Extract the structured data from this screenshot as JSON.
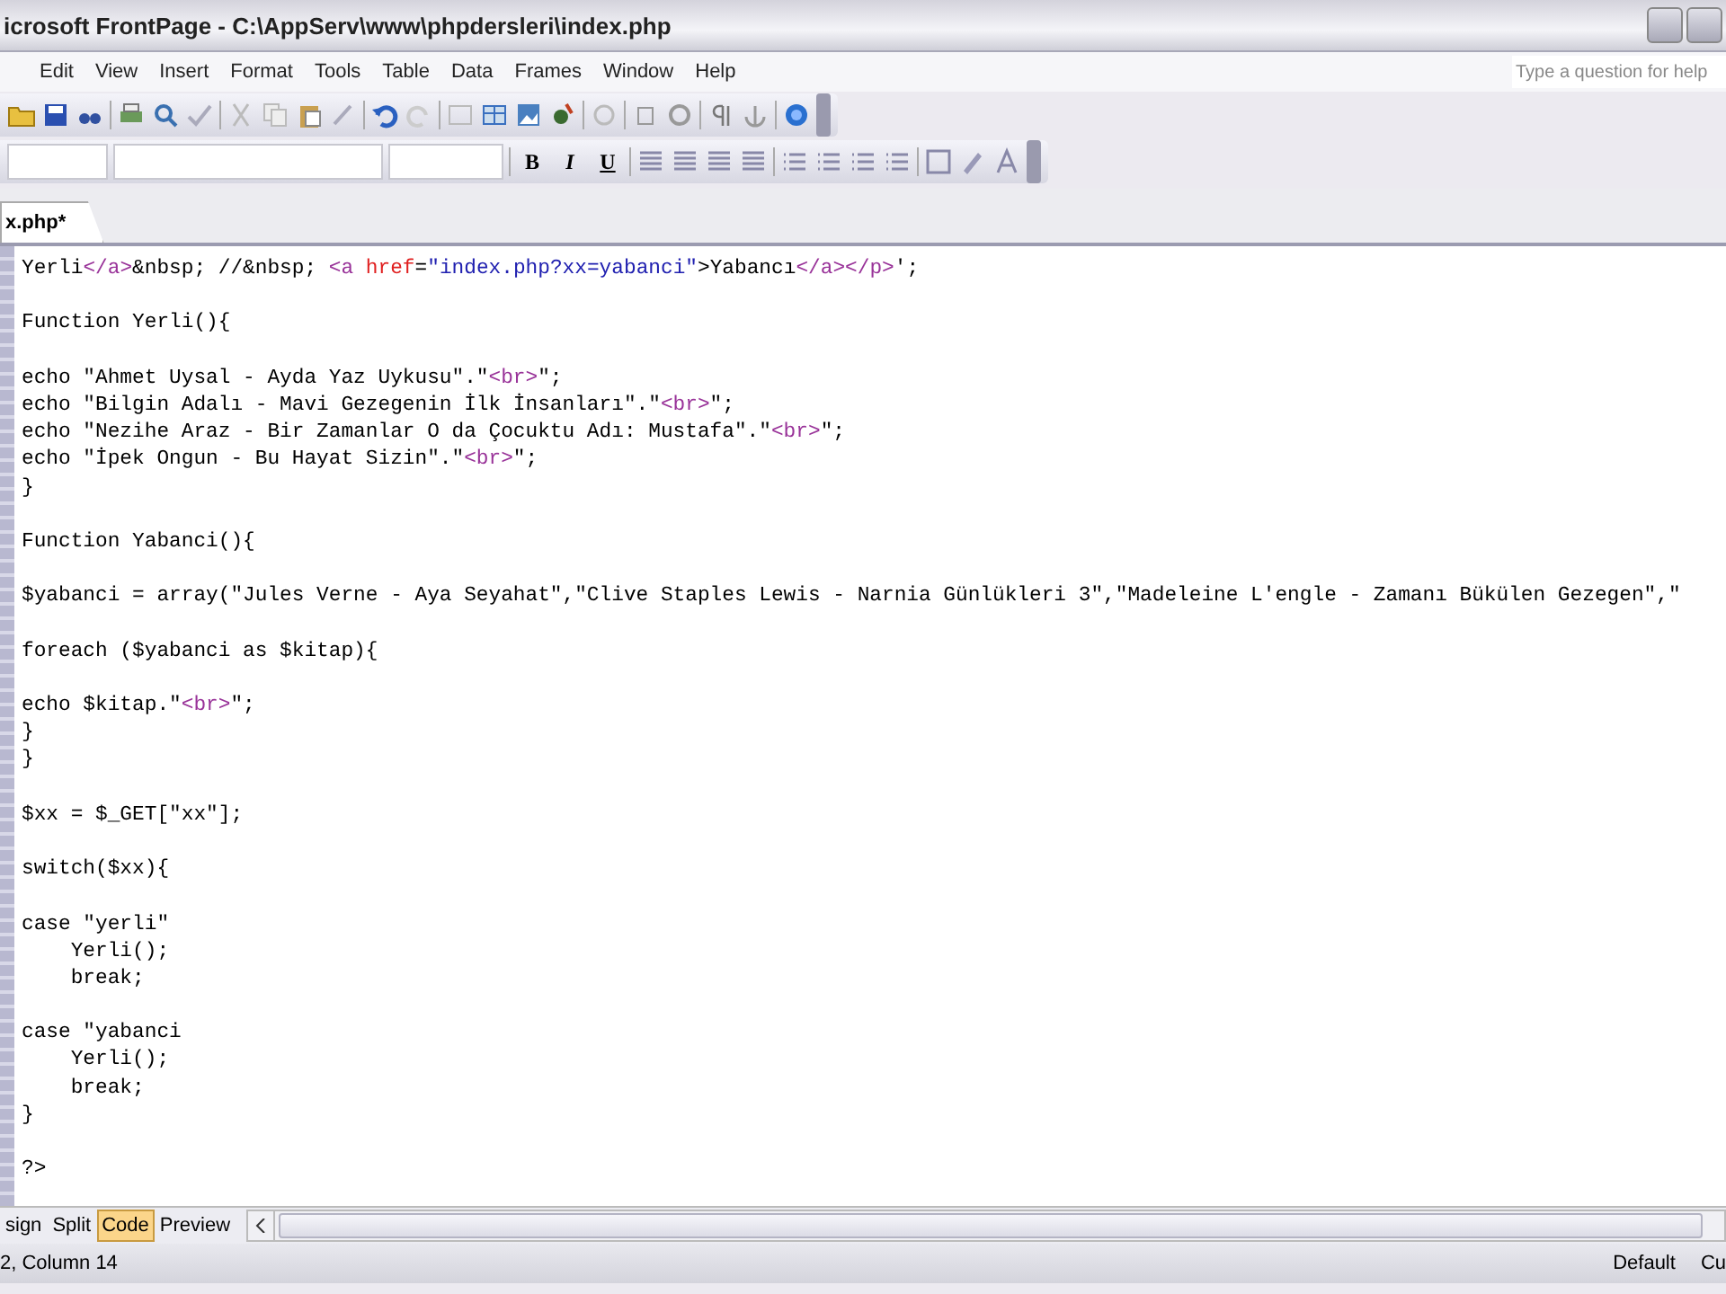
{
  "window": {
    "title": "icrosoft FrontPage - C:\\AppServ\\www\\phpdersleri\\index.php"
  },
  "menu": [
    "Edit",
    "View",
    "Insert",
    "Format",
    "Tools",
    "Table",
    "Data",
    "Frames",
    "Window",
    "Help"
  ],
  "help_box": {
    "placeholder": "Type a question for help"
  },
  "format_toolbar": {
    "buttons": [
      "B",
      "I",
      "U"
    ]
  },
  "tabs": [
    {
      "label": "x.php*",
      "selected": true
    }
  ],
  "code_blocks": [
    [
      [
        {
          "kind": "code",
          "text": "Yerli"
        },
        {
          "kind": "tag",
          "text": "</a>"
        },
        {
          "kind": "code",
          "text": "&nbsp; //&nbsp; "
        },
        {
          "kind": "tag",
          "text": "<a "
        },
        {
          "kind": "attr",
          "text": "href"
        },
        {
          "kind": "code",
          "text": "="
        },
        {
          "kind": "value",
          "text": "\"index.php?xx=yabanci\""
        },
        {
          "kind": "code",
          "text": ">Yabancı"
        },
        {
          "kind": "tag",
          "text": "</a></p>"
        },
        {
          "kind": "code",
          "text": "';"
        }
      ]
    ],
    [
      [
        {
          "kind": "code",
          "text": "Function Yerli(){"
        }
      ]
    ],
    [
      [
        {
          "kind": "code",
          "text": "echo \"Ahmet Uysal - Ayda Yaz Uykusu\".\""
        },
        {
          "kind": "tag",
          "text": "<br>"
        },
        {
          "kind": "code",
          "text": "\";"
        }
      ],
      [
        {
          "kind": "code",
          "text": "echo \"Bilgin Adalı - Mavi Gezegenin İlk İnsanları\".\""
        },
        {
          "kind": "tag",
          "text": "<br>"
        },
        {
          "kind": "code",
          "text": "\";"
        }
      ],
      [
        {
          "kind": "code",
          "text": "echo \"Nezihe Araz - Bir Zamanlar O da Çocuktu Adı: Mustafa\".\""
        },
        {
          "kind": "tag",
          "text": "<br>"
        },
        {
          "kind": "code",
          "text": "\";"
        }
      ],
      [
        {
          "kind": "code",
          "text": "echo \"İpek Ongun - Bu Hayat Sizin\".\""
        },
        {
          "kind": "tag",
          "text": "<br>"
        },
        {
          "kind": "code",
          "text": "\";"
        }
      ],
      [
        {
          "kind": "code",
          "text": "}"
        }
      ]
    ],
    [
      [
        {
          "kind": "code",
          "text": "Function Yabanci(){"
        }
      ]
    ],
    [
      [
        {
          "kind": "code",
          "text": "$yabanci = array(\"Jules Verne - Aya Seyahat\",\"Clive Staples Lewis - Narnia Günlükleri 3\",\"Madeleine L'engle - Zamanı Bükülen Gezegen\",\""
        }
      ]
    ],
    [
      [
        {
          "kind": "code",
          "text": "foreach ($yabanci as $kitap){"
        }
      ]
    ],
    [
      [
        {
          "kind": "code",
          "text": "echo $kitap.\""
        },
        {
          "kind": "tag",
          "text": "<br>"
        },
        {
          "kind": "code",
          "text": "\";"
        }
      ],
      [
        {
          "kind": "code",
          "text": "}"
        }
      ],
      [
        {
          "kind": "code",
          "text": "}"
        }
      ]
    ],
    [
      [
        {
          "kind": "code",
          "text": "$xx = $_GET[\"xx\"];"
        }
      ]
    ],
    [
      [
        {
          "kind": "code",
          "text": "switch($xx){"
        }
      ]
    ],
    [
      [
        {
          "kind": "code",
          "text": "case \"yerli\""
        }
      ],
      [
        {
          "kind": "code",
          "text": "    Yerli();"
        }
      ],
      [
        {
          "kind": "code",
          "text": "    break;"
        }
      ]
    ],
    [
      [
        {
          "kind": "code",
          "text": "case \"yabanci"
        }
      ],
      [
        {
          "kind": "code",
          "text": "    Yerli();"
        }
      ],
      [
        {
          "kind": "code",
          "text": "    break;"
        }
      ],
      [
        {
          "kind": "code",
          "text": "}"
        }
      ]
    ],
    [
      [
        {
          "kind": "code",
          "text": "?>"
        }
      ]
    ]
  ],
  "view_tabs": [
    {
      "label": "sign",
      "selected": false
    },
    {
      "label": "Split",
      "selected": false
    },
    {
      "label": "Code",
      "selected": true
    },
    {
      "label": "Preview",
      "selected": false
    }
  ],
  "status_bar": {
    "position": "2, Column 14",
    "fields": [
      "Default",
      "Cu"
    ]
  }
}
